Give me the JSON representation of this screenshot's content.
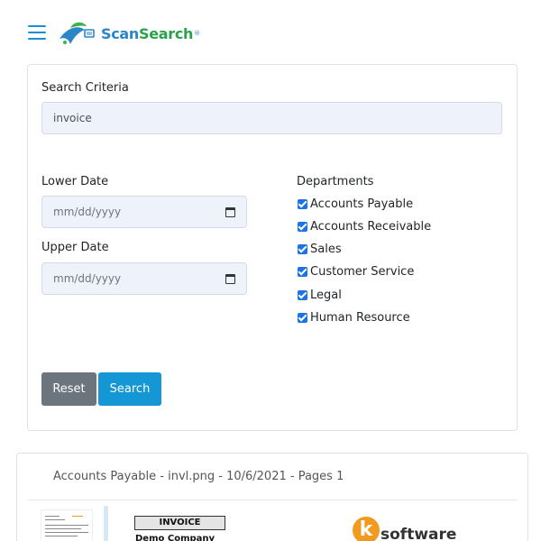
{
  "header": {
    "logo_scan": "Scan",
    "logo_search": "Search",
    "logo_reg": "®"
  },
  "form": {
    "criteria_label": "Search Criteria",
    "criteria_value": "invoice",
    "lower_date_label": "Lower Date",
    "lower_date_placeholder": "mm/dd/yyyy",
    "upper_date_label": "Upper Date",
    "upper_date_placeholder": "mm/dd/yyyy",
    "departments_label": "Departments",
    "departments": [
      {
        "label": "Accounts Payable",
        "checked": true
      },
      {
        "label": "Accounts Receivable",
        "checked": true
      },
      {
        "label": "Sales",
        "checked": true
      },
      {
        "label": "Customer Service",
        "checked": true
      },
      {
        "label": "Legal",
        "checked": true
      },
      {
        "label": "Human Resource",
        "checked": true
      }
    ],
    "reset_label": "Reset",
    "search_label": "Search"
  },
  "result": {
    "title": "Accounts Payable - invl.png - 10/6/2021 - Pages 1",
    "invoice_heading": "INVOICE",
    "company": "Demo Company",
    "vendor_logo_letter": "k",
    "vendor_logo_text": "software"
  },
  "colors": {
    "accent": "#1497d4",
    "reset": "#6c757d",
    "checkbox": "#1a73e8"
  }
}
